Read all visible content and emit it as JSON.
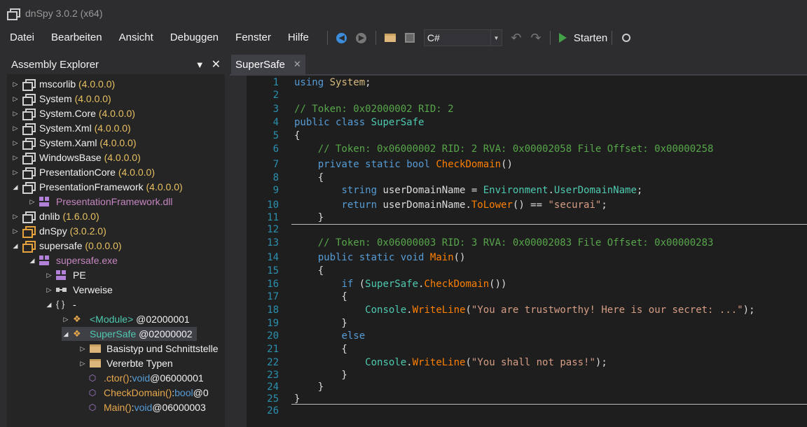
{
  "window": {
    "title": "dnSpy 3.0.2 (x64)"
  },
  "menu": [
    "Datei",
    "Bearbeiten",
    "Ansicht",
    "Debuggen",
    "Fenster",
    "Hilfe"
  ],
  "toolbar": {
    "language": "C#",
    "start_label": "Starten"
  },
  "explorer": {
    "title": "Assembly Explorer",
    "nodes": [
      {
        "label": "mscorlib",
        "ver": "(4.0.0.0)"
      },
      {
        "label": "System",
        "ver": "(4.0.0.0)"
      },
      {
        "label": "System.Core",
        "ver": "(4.0.0.0)"
      },
      {
        "label": "System.Xml",
        "ver": "(4.0.0.0)"
      },
      {
        "label": "System.Xaml",
        "ver": "(4.0.0.0)"
      },
      {
        "label": "WindowsBase",
        "ver": "(4.0.0.0)"
      },
      {
        "label": "PresentationCore",
        "ver": "(4.0.0.0)"
      },
      {
        "label": "PresentationFramework",
        "ver": "(4.0.0.0)"
      },
      {
        "label": "PresentationFramework.dll",
        "ver": ""
      },
      {
        "label": "dnlib",
        "ver": "(1.6.0.0)"
      },
      {
        "label": "dnSpy",
        "ver": "(3.0.2.0)"
      },
      {
        "label": "supersafe",
        "ver": "(0.0.0.0)"
      },
      {
        "label": "supersafe.exe",
        "ver": ""
      },
      {
        "label": "PE",
        "ver": ""
      },
      {
        "label": "Verweise",
        "ver": ""
      },
      {
        "label": "-",
        "ver": ""
      },
      {
        "label": "<Module>",
        "ver": "@02000001"
      },
      {
        "label": "SuperSafe",
        "ver": "@02000002"
      },
      {
        "label": "Basistyp und Schnittstelle",
        "ver": ""
      },
      {
        "label": "Vererbte Typen",
        "ver": ""
      },
      {
        "label": ".ctor()",
        "sep": " : ",
        "type": "void",
        "ver": " @06000001"
      },
      {
        "label": "CheckDomain()",
        "sep": " : ",
        "type": "bool",
        "ver": " @0"
      },
      {
        "label": "Main()",
        "sep": " : ",
        "type": "void",
        "ver": " @06000003"
      }
    ]
  },
  "tab": {
    "label": "SuperSafe"
  },
  "code_lines": [
    {
      "n": "1",
      "t": "using System;"
    },
    {
      "n": "2",
      "t": ""
    },
    {
      "n": "3",
      "t": "// Token: 0x02000002 RID: 2"
    },
    {
      "n": "4",
      "t": "public class SuperSafe"
    },
    {
      "n": "5",
      "t": "{"
    },
    {
      "n": "6",
      "t": "    // Token: 0x06000002 RID: 2 RVA: 0x00002058 File Offset: 0x00000258"
    },
    {
      "n": "7",
      "t": "    private static bool CheckDomain()"
    },
    {
      "n": "8",
      "t": "    {"
    },
    {
      "n": "9",
      "t": "        string userDomainName = Environment.UserDomainName;"
    },
    {
      "n": "10",
      "t": "        return userDomainName.ToLower() == \"securai\";"
    },
    {
      "n": "11",
      "t": "    }"
    },
    {
      "n": "12",
      "t": ""
    },
    {
      "n": "13",
      "t": "    // Token: 0x06000003 RID: 3 RVA: 0x00002083 File Offset: 0x00000283"
    },
    {
      "n": "14",
      "t": "    public static void Main()"
    },
    {
      "n": "15",
      "t": "    {"
    },
    {
      "n": "16",
      "t": "        if (SuperSafe.CheckDomain())"
    },
    {
      "n": "17",
      "t": "        {"
    },
    {
      "n": "18",
      "t": "            Console.WriteLine(\"You are trustworthy! Here is our secret: ...\");"
    },
    {
      "n": "19",
      "t": "        }"
    },
    {
      "n": "20",
      "t": "        else"
    },
    {
      "n": "21",
      "t": "        {"
    },
    {
      "n": "22",
      "t": "            Console.WriteLine(\"You shall not pass!\");"
    },
    {
      "n": "23",
      "t": "        }"
    },
    {
      "n": "24",
      "t": "    }"
    },
    {
      "n": "25",
      "t": "}"
    },
    {
      "n": "26",
      "t": ""
    }
  ]
}
